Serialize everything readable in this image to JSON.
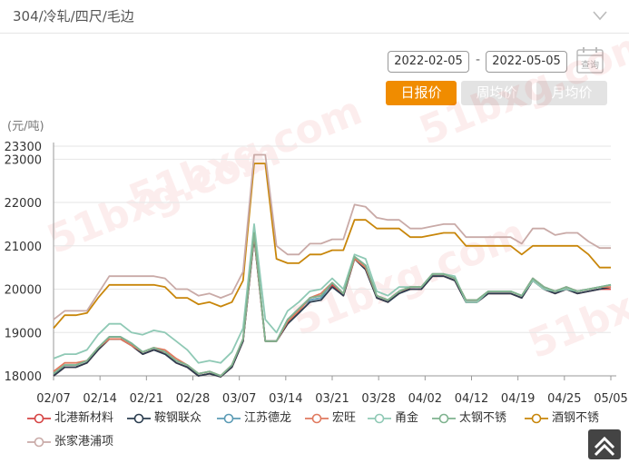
{
  "header": {
    "title": "304/冷轧/四尺/毛边",
    "collapse_icon": "chevron-down-icon"
  },
  "controls": {
    "start_date": "2022-02-05",
    "separator": "-",
    "end_date": "2022-05-05",
    "query_label": "查询",
    "tabs": [
      {
        "label": "日报价",
        "active": true
      },
      {
        "label": "周均价",
        "active": false
      },
      {
        "label": "月均价",
        "active": false
      }
    ],
    "active_color": "#f08c00",
    "inactive_color": "#e3e3e3"
  },
  "watermark": "51bxg.com",
  "chart_data": {
    "type": "line",
    "unit_label": "(元/吨)",
    "ylim": [
      18000,
      23300
    ],
    "yticks": [
      18000,
      19000,
      20000,
      21000,
      22000,
      23000,
      23300
    ],
    "x_tick_labels": [
      "02/07",
      "02/14",
      "02/21",
      "02/28",
      "03/07",
      "03/14",
      "03/21",
      "03/28",
      "04/02",
      "04/12",
      "04/19",
      "04/25",
      "05/05"
    ],
    "grid": true,
    "legend_position": "bottom",
    "series": [
      {
        "name": "北港新材料",
        "color": "#d64545",
        "values": [
          18000,
          18200,
          18200,
          18300,
          18600,
          18850,
          18850,
          18700,
          18500,
          18600,
          18550,
          18300,
          18200,
          18000,
          18050,
          17980,
          18200,
          18800,
          21200,
          18800,
          18800,
          19200,
          19500,
          19800,
          19850,
          20100,
          19850,
          20700,
          20500,
          19800,
          19700,
          19950,
          20000,
          20000,
          20300,
          20300,
          20200,
          19700,
          19700,
          19900,
          19900,
          19900,
          19800,
          20200,
          20000,
          19900,
          20000,
          19900,
          19950,
          20000,
          20000
        ]
      },
      {
        "name": "鞍钢联众",
        "color": "#2c3e50",
        "values": [
          18000,
          18200,
          18200,
          18300,
          18600,
          18850,
          18850,
          18700,
          18500,
          18600,
          18500,
          18300,
          18200,
          18000,
          18050,
          17980,
          18200,
          18800,
          21200,
          18800,
          18800,
          19200,
          19450,
          19700,
          19750,
          20050,
          19850,
          20700,
          20450,
          19800,
          19700,
          19900,
          20000,
          20000,
          20300,
          20300,
          20200,
          19700,
          19700,
          19900,
          19900,
          19900,
          19800,
          20200,
          20000,
          19900,
          20000,
          19900,
          19950,
          20000,
          20050
        ]
      },
      {
        "name": "江苏德龙",
        "color": "#5b9bb5",
        "values": [
          18050,
          18250,
          18250,
          18350,
          18650,
          18900,
          18900,
          18750,
          18550,
          18650,
          18550,
          18350,
          18250,
          18050,
          18100,
          18000,
          18250,
          18850,
          21300,
          18800,
          18800,
          19300,
          19550,
          19750,
          19800,
          20150,
          19900,
          20750,
          20550,
          19850,
          19750,
          19950,
          20050,
          20050,
          20350,
          20350,
          20250,
          19750,
          19750,
          19950,
          19950,
          19950,
          19850,
          20250,
          20050,
          19950,
          20050,
          19950,
          20000,
          20050,
          20100
        ]
      },
      {
        "name": "宏旺",
        "color": "#e07a5f",
        "values": [
          18100,
          18300,
          18300,
          18350,
          18650,
          18850,
          18850,
          18700,
          18550,
          18650,
          18600,
          18400,
          18250,
          18050,
          18100,
          18000,
          18250,
          18850,
          21250,
          18800,
          18800,
          19250,
          19500,
          19800,
          19900,
          20150,
          19900,
          20700,
          20500,
          19850,
          19750,
          19950,
          20050,
          20050,
          20350,
          20350,
          20250,
          19750,
          19750,
          19950,
          19950,
          19950,
          19850,
          20250,
          20050,
          19950,
          20050,
          19950,
          20000,
          20050,
          20050
        ]
      },
      {
        "name": "甬金",
        "color": "#8fc9b5",
        "values": [
          18400,
          18500,
          18500,
          18600,
          18950,
          19200,
          19200,
          19000,
          18950,
          19050,
          19000,
          18800,
          18600,
          18300,
          18350,
          18300,
          18550,
          19100,
          21500,
          19300,
          19000,
          19500,
          19700,
          19950,
          20000,
          20250,
          20000,
          20800,
          20700,
          19950,
          19850,
          20050,
          20050,
          20050,
          20350,
          20350,
          20300,
          19700,
          19700,
          19950,
          19950,
          19950,
          19850,
          20200,
          20000,
          19950,
          20000,
          19950,
          20000,
          20050,
          20100
        ]
      },
      {
        "name": "太钢不锈",
        "color": "#7fb38f",
        "values": [
          18050,
          18250,
          18250,
          18350,
          18650,
          18900,
          18900,
          18750,
          18550,
          18650,
          18550,
          18350,
          18250,
          18050,
          18100,
          18000,
          18250,
          18850,
          21300,
          18800,
          18800,
          19300,
          19550,
          19800,
          19850,
          20150,
          19900,
          20750,
          20550,
          19850,
          19750,
          19950,
          20050,
          20050,
          20350,
          20350,
          20250,
          19750,
          19750,
          19950,
          19950,
          19950,
          19850,
          20250,
          20050,
          19950,
          20050,
          19950,
          20000,
          20050,
          20100
        ]
      },
      {
        "name": "酒钢不锈",
        "color": "#c8860a",
        "values": [
          19100,
          19400,
          19400,
          19450,
          19800,
          20100,
          20100,
          20100,
          20100,
          20100,
          20050,
          19800,
          19800,
          19650,
          19700,
          19600,
          19700,
          20200,
          22900,
          22900,
          20700,
          20600,
          20600,
          20800,
          20800,
          20900,
          20900,
          21600,
          21600,
          21400,
          21400,
          21400,
          21200,
          21200,
          21250,
          21300,
          21300,
          21000,
          21000,
          21000,
          21000,
          21000,
          20800,
          21000,
          21000,
          21000,
          21000,
          21000,
          20800,
          20500,
          20500
        ]
      },
      {
        "name": "张家港浦项",
        "color": "#c9aaa7",
        "values": [
          19300,
          19500,
          19500,
          19500,
          19900,
          20300,
          20300,
          20300,
          20300,
          20300,
          20250,
          20000,
          20000,
          19850,
          19900,
          19800,
          19900,
          20400,
          23100,
          23100,
          21000,
          20800,
          20800,
          21050,
          21050,
          21150,
          21150,
          21950,
          21900,
          21650,
          21600,
          21600,
          21400,
          21400,
          21450,
          21500,
          21500,
          21200,
          21200,
          21200,
          21200,
          21200,
          21050,
          21400,
          21400,
          21250,
          21300,
          21300,
          21100,
          20950,
          20950
        ]
      }
    ]
  }
}
